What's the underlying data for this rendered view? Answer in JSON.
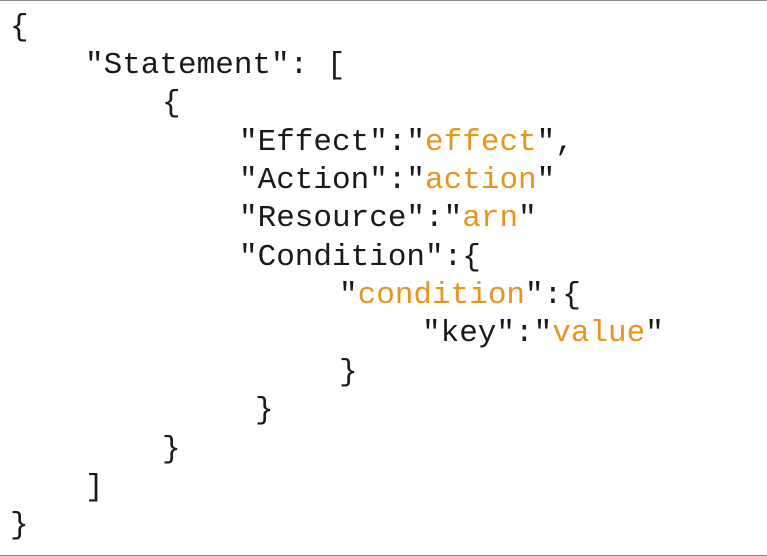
{
  "colors": {
    "text": "#1a1a1a",
    "highlight": "#e8951e",
    "border": "#8a8a8a"
  },
  "code": {
    "open_brace": "{",
    "statement_key": "\"Statement\": [",
    "obj_open": "{",
    "effect": {
      "key": "\"Effect\":\"",
      "value": "effect",
      "suffix": "\","
    },
    "action": {
      "key": "\"Action\":\"",
      "value": "action",
      "suffix": "\""
    },
    "resource": {
      "key": "\"Resource\":\"",
      "value": "arn",
      "suffix": "\""
    },
    "condition_key": "\"Condition\":{",
    "condition": {
      "prefix": "\"",
      "value": "condition",
      "suffix": "\":{"
    },
    "kv": {
      "key": "\"key\":\"",
      "value": "value",
      "suffix": "\""
    },
    "inner_close": "}",
    "condition_close": "}",
    "obj_close": "}",
    "array_close": "]",
    "close_brace": "}"
  }
}
